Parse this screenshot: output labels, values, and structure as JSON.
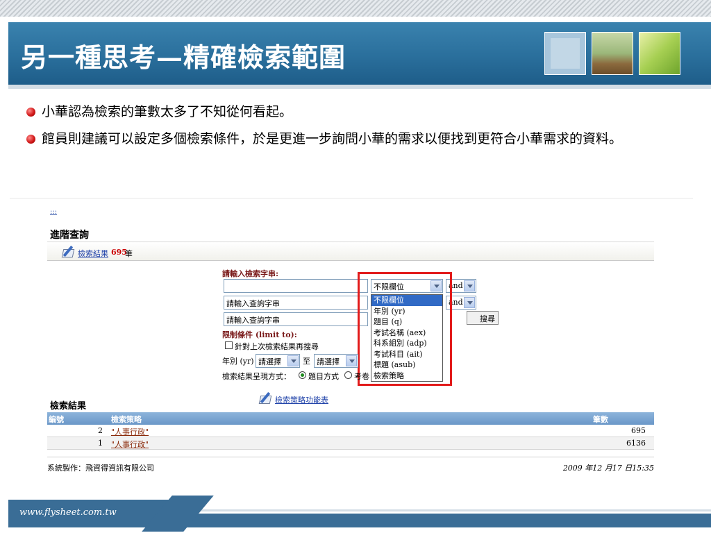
{
  "slide": {
    "title": "另一種思考—精確檢索範圍",
    "bullets": [
      "小華認為檢索的筆數太多了不知從何看起。",
      "館員則建議可以設定多個檢索條件，於是更進一步詢問小華的需求以便找到更符合小華需求的資料。"
    ],
    "footer_url": "www.flysheet.com.tw"
  },
  "screenshot": {
    "top_link": ":::",
    "heading": "進階查詢",
    "result_link": "檢索結果",
    "result_count": "695",
    "result_unit": "筆",
    "form_label": "請輸入檢索字串:",
    "inputs": [
      {
        "value": ""
      },
      {
        "value": "請輸入查詢字串"
      },
      {
        "value": "請輸入查詢字串"
      }
    ],
    "field_select": "不限欄位",
    "bool_selects": [
      "and",
      "and"
    ],
    "search_button": "搜尋",
    "dropdown_options": [
      "不限欄位",
      "年別 (yr)",
      "題目 (q)",
      "考試名稱 (aex)",
      "科系組別 (adp)",
      "考試科目 (ait)",
      "標題 (asub)",
      "檢索策略"
    ],
    "dropdown_selected_index": 0,
    "limit_label": "限制條件 (limit to):",
    "checkbox_label": "針對上次檢索結果再搜尋",
    "year_label": "年別 (yr)",
    "year_from": "請選擇",
    "year_to_word": "至",
    "year_to": "請選擇",
    "display_label": "檢索結果呈現方式：",
    "radio_1": "題目方式",
    "radio_2": "考卷",
    "function_link": "檢索策略功能表",
    "results_title": "檢索結果",
    "table": {
      "headers": [
        "編號",
        "檢索策略",
        "筆數"
      ],
      "rows": [
        {
          "no": "2",
          "strategy": "\"人事行政\"",
          "count": "695"
        },
        {
          "no": "1",
          "strategy": "\"人事行政\"",
          "count": "6136"
        }
      ]
    },
    "footer_left": "系統製作：飛資得資訊有限公司",
    "footer_right": "2009 年12 月17 日15:35"
  },
  "colors": {
    "title_bar": "#2a6f9c",
    "highlight_frame": "#e21b1b",
    "bullet": "#d21a1a",
    "table_header": "#6a97c8",
    "selected_option": "#316ac5"
  }
}
